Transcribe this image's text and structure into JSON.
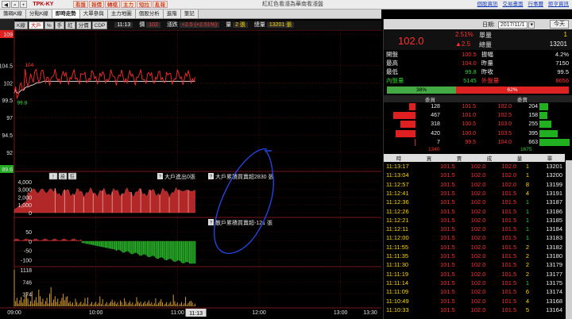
{
  "topbar": {
    "symbol": "TPK-KY",
    "buttons": [
      "看盤",
      "報價",
      "轉檔",
      "主力",
      "短拉",
      "亂報"
    ],
    "title": "紅紅色看漲為華南看漲盤",
    "links": [
      "個股資訊",
      "交易畫面",
      "行事曆",
      "鉅亨資訊"
    ]
  },
  "tabs": [
    "籌碼K線",
    "分點K線",
    "即時走勢",
    "大單參與",
    "主力地圖",
    "個股分析",
    "進階",
    "筆記"
  ],
  "active_tab": 2,
  "chart_header": {
    "buttons": [
      "K線",
      "大戶",
      "%",
      "手",
      "紅",
      "分價",
      "CDP"
    ],
    "time": "11:13",
    "price_label": "價",
    "price": "102",
    "change_label": "漲跌",
    "change": "+2.5 (+2.51%)",
    "vol_label": "量",
    "vol": "2 張",
    "total_label": "總量",
    "total": "13201 張"
  },
  "price_axis": [
    "109",
    "104.5",
    "102",
    "99.5",
    "97",
    "94.5",
    "92",
    "89.6"
  ],
  "annotations": {
    "high": "104",
    "low": "99.8"
  },
  "panel2": {
    "buttons": [
      "!",
      "設",
      "狂"
    ],
    "axis": [
      "4,000",
      "3,000",
      "2,000",
      "1,000",
      "0"
    ],
    "label_a": "大戶進出0張",
    "label_b": "大戶累積買賣超2830 張"
  },
  "panel3": {
    "axis": [
      "50",
      "0",
      "-50",
      "-100"
    ],
    "label": "散戶累積買賣超-121 張"
  },
  "panel4": {
    "axis": [
      "1118",
      "746",
      "374"
    ]
  },
  "time_axis": [
    "09:00",
    "10:00",
    "11:00",
    "12:00",
    "13:00",
    "13:30"
  ],
  "cursor_time": "11:13",
  "right_panel": {
    "date_label": "日期:",
    "date": "2017/11/1",
    "today_label": "今天",
    "price": "102.0",
    "pct": "2.51%",
    "chg": "▲2.5",
    "quote_rows": [
      {
        "a": "單量",
        "av": "1",
        "b": "",
        "bv": ""
      },
      {
        "a": "總量",
        "av": "13201",
        "b": "",
        "bv": ""
      }
    ],
    "stats": [
      {
        "k1": "開盤",
        "v1": "100.5",
        "k2": "振幅",
        "v2": "4.2%"
      },
      {
        "k1": "最高",
        "v1": "104.0",
        "k2": "昨量",
        "v2": "7150"
      },
      {
        "k1": "最低",
        "v1": "99.8",
        "k2": "昨收",
        "v2": "99.5"
      },
      {
        "k1": "內盤量",
        "v1": "5145",
        "k2": "外盤量",
        "v2": "8656"
      }
    ],
    "ratio": {
      "buy": "38%",
      "sell": "62%",
      "buy_frac": 0.38
    },
    "orderbook_head": {
      "bid": "委買",
      "ask": "委賣"
    },
    "orderbook": [
      {
        "bv": "128",
        "bp": "101.5",
        "ap": "102.0",
        "av": "204",
        "bf": 0.2,
        "af": 0.3
      },
      {
        "bv": "467",
        "bp": "101.0",
        "ap": "102.5",
        "av": "158",
        "bf": 0.75,
        "af": 0.25
      },
      {
        "bv": "318",
        "bp": "100.5",
        "ap": "103.0",
        "av": "255",
        "bf": 0.5,
        "af": 0.4
      },
      {
        "bv": "420",
        "bp": "100.0",
        "ap": "103.5",
        "av": "395",
        "bf": 0.65,
        "af": 0.6
      },
      {
        "bv": "7",
        "bp": "99.5",
        "ap": "104.0",
        "av": "663",
        "bf": 0.02,
        "af": 1.0
      }
    ],
    "ob_totals": {
      "bid": "1340",
      "ask": "1675"
    },
    "trade_head": [
      "時",
      "買",
      "賣",
      "成",
      "量",
      "單"
    ],
    "trades": [
      [
        "11:13:17",
        "101.5",
        "102.0",
        "102.0",
        "1",
        "13201"
      ],
      [
        "11:13:04",
        "101.5",
        "102.0",
        "102.0",
        "1",
        "13200"
      ],
      [
        "11:12:57",
        "101.5",
        "102.0",
        "102.0",
        "8",
        "13199"
      ],
      [
        "11:12:41",
        "101.5",
        "102.0",
        "101.5",
        "4",
        "13191"
      ],
      [
        "11:12:36",
        "101.5",
        "102.0",
        "101.5",
        "1",
        "13187"
      ],
      [
        "11:12:26",
        "101.5",
        "102.0",
        "101.5",
        "1",
        "13186"
      ],
      [
        "11:12:21",
        "101.5",
        "102.0",
        "101.5",
        "1",
        "13185"
      ],
      [
        "11:12:11",
        "101.5",
        "102.0",
        "101.5",
        "1",
        "13184"
      ],
      [
        "11:12:00",
        "101.5",
        "102.0",
        "101.5",
        "1",
        "13183"
      ],
      [
        "11:11:55",
        "101.5",
        "102.0",
        "101.5",
        "2",
        "13182"
      ],
      [
        "11:11:35",
        "101.5",
        "102.0",
        "101.5",
        "2",
        "13180"
      ],
      [
        "11:11:30",
        "101.5",
        "102.0",
        "101.5",
        "2",
        "13179"
      ],
      [
        "11:11:19",
        "101.5",
        "102.0",
        "101.5",
        "2",
        "13177"
      ],
      [
        "11:11:14",
        "101.5",
        "102.0",
        "101.5",
        "1",
        "13175"
      ],
      [
        "11:11:09",
        "101.5",
        "102.0",
        "101.5",
        "6",
        "13174"
      ],
      [
        "11:10:49",
        "101.5",
        "102.0",
        "101.5",
        "4",
        "13168"
      ],
      [
        "11:10:33",
        "101.5",
        "102.0",
        "101.5",
        "5",
        "13164"
      ]
    ]
  },
  "colors": {
    "up": "#ff3030",
    "down": "#30d030",
    "accent": "#ffd700"
  }
}
